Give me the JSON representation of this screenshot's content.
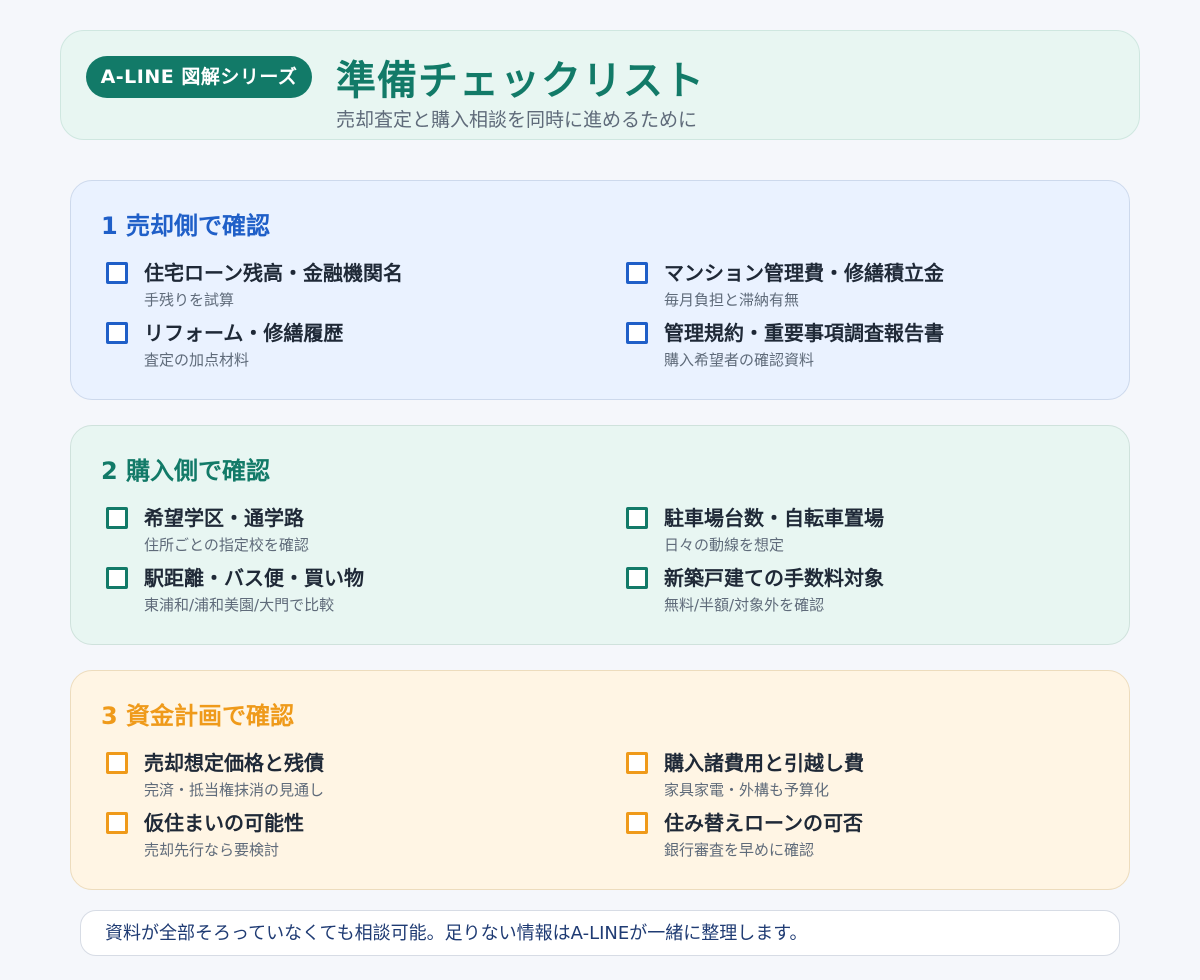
{
  "header": {
    "badge": "A-LINE 図解シリーズ",
    "title": "準備チェックリスト",
    "subtitle": "売却査定と購入相談を同時に進めるために"
  },
  "sections": [
    {
      "title": "1 売却側で確認",
      "accent_color": "#1f5fc8",
      "items": [
        {
          "title": "住宅ローン残高・金融機関名",
          "note": "手残りを試算"
        },
        {
          "title": "マンション管理費・修繕積立金",
          "note": "毎月負担と滞納有無"
        },
        {
          "title": "リフォーム・修繕履歴",
          "note": "査定の加点材料"
        },
        {
          "title": "管理規約・重要事項調査報告書",
          "note": "購入希望者の確認資料"
        }
      ]
    },
    {
      "title": "2 購入側で確認",
      "accent_color": "#127a68",
      "items": [
        {
          "title": "希望学区・通学路",
          "note": "住所ごとの指定校を確認"
        },
        {
          "title": "駐車場台数・自転車置場",
          "note": "日々の動線を想定"
        },
        {
          "title": "駅距離・バス便・買い物",
          "note": "東浦和/浦和美園/大門で比較"
        },
        {
          "title": "新築戸建ての手数料対象",
          "note": "無料/半額/対象外を確認"
        }
      ]
    },
    {
      "title": "3 資金計画で確認",
      "accent_color": "#ef9a1a",
      "items": [
        {
          "title": "売却想定価格と残債",
          "note": "完済・抵当権抹消の見通し"
        },
        {
          "title": "購入諸費用と引越し費",
          "note": "家具家電・外構も予算化"
        },
        {
          "title": "仮住まいの可能性",
          "note": "売却先行なら要検討"
        },
        {
          "title": "住み替えローンの可否",
          "note": "銀行審査を早めに確認"
        }
      ]
    }
  ],
  "footer": {
    "note": "資料が全部そろっていなくても相談可能。足りない情報はA-LINEが一緒に整理します。"
  }
}
